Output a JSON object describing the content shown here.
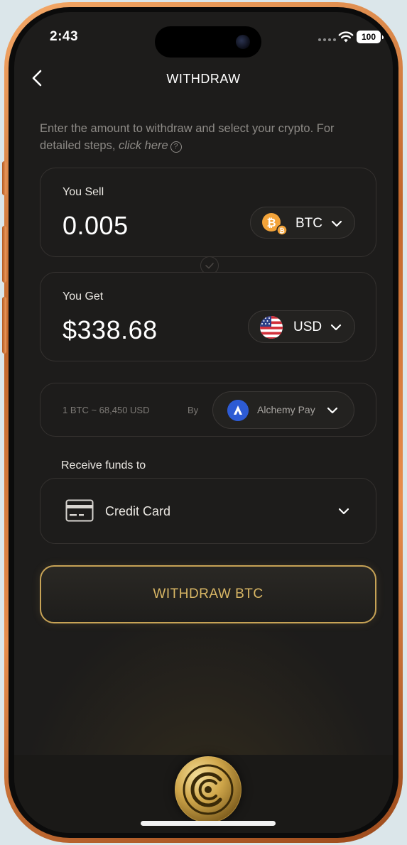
{
  "status_bar": {
    "time": "2:43",
    "battery": "100"
  },
  "header": {
    "title": "WITHDRAW"
  },
  "instructions": {
    "text": "Enter the amount to withdraw and select your crypto. For detailed steps, ",
    "link": "click here",
    "help_glyph": "?"
  },
  "sell": {
    "label": "You Sell",
    "amount": "0.005",
    "currency": "BTC",
    "icon": "bitcoin-icon"
  },
  "get": {
    "label": "You Get",
    "amount": "$338.68",
    "currency": "USD",
    "icon": "us-flag-icon"
  },
  "rate": {
    "text": "1 BTC ~ 68,450 USD",
    "by_label": "By",
    "provider": "Alchemy Pay",
    "provider_icon": "alchemy-pay-icon"
  },
  "receive": {
    "label": "Receive funds to",
    "method": "Credit Card",
    "icon": "credit-card-icon"
  },
  "action": {
    "withdraw_label": "WITHDRAW BTC"
  },
  "colors": {
    "accent": "#c7a356",
    "background": "#1d1c1b",
    "bitcoin": "#f2a33a",
    "provider_blue": "#2d5bd4"
  }
}
